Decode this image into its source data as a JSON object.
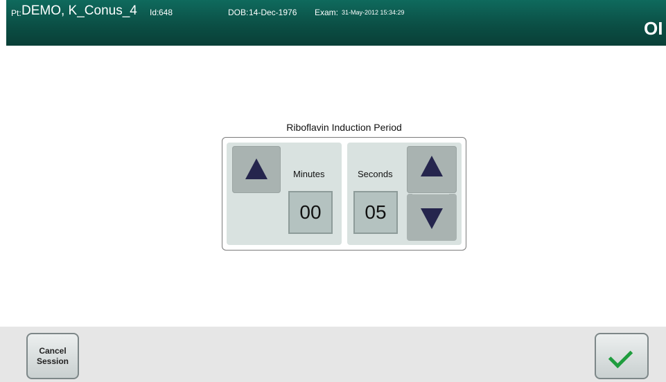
{
  "header": {
    "pt_prefix": "Pt:",
    "patient_name": "DEMO, K_Conus_4",
    "id_prefix": "Id:",
    "id_value": "648",
    "dob_prefix": "DOB:",
    "dob_value": "14-Dec-1976",
    "exam_prefix": "Exam:",
    "exam_value": "31-May-2012 15:34:29",
    "mode_text": "OI"
  },
  "panel": {
    "title": "Riboflavin Induction Period",
    "minutes_label": "Minutes",
    "minutes_value": "00",
    "seconds_label": "Seconds",
    "seconds_value": "05"
  },
  "footer": {
    "cancel_label": "Cancel\nSession"
  },
  "icons": {
    "minutes_up": "triangle-up-icon",
    "seconds_up": "triangle-up-icon",
    "seconds_down": "triangle-down-icon",
    "confirm": "checkmark-icon"
  },
  "colors": {
    "header_bg": "#0b4f45",
    "panel_bg": "#d9e2e0",
    "arrow": "#25254d",
    "check": "#1f9d3e"
  }
}
